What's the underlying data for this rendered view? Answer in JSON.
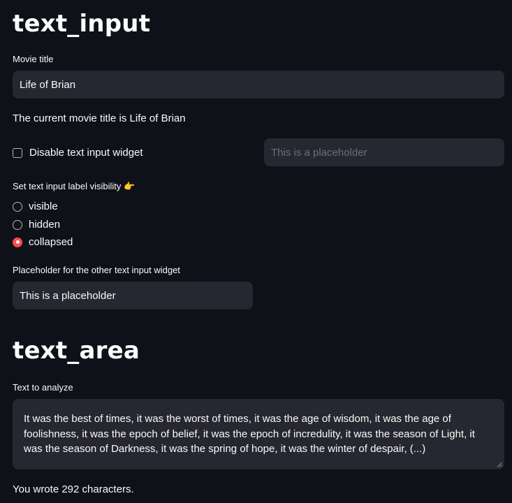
{
  "text_input_section": {
    "heading": "text_input",
    "movie_title_label": "Movie title",
    "movie_title_value": "Life of Brian",
    "current_title_text": "The current movie title is Life of Brian",
    "disable_checkbox_label": "Disable text input widget",
    "disable_checkbox_checked": false,
    "other_input_placeholder": "This is a placeholder",
    "visibility_label": "Set text input label visibility 👉",
    "visibility_options": [
      {
        "label": "visible",
        "selected": false
      },
      {
        "label": "hidden",
        "selected": false
      },
      {
        "label": "collapsed",
        "selected": true
      }
    ],
    "placeholder_label": "Placeholder for the other text input widget",
    "placeholder_value": "This is a placeholder"
  },
  "text_area_section": {
    "heading": "text_area",
    "analyze_label": "Text to analyze",
    "analyze_value": "It was the best of times, it was the worst of times, it was the age of wisdom, it was the age of foolishness, it was the epoch of belief, it was the epoch of incredulity, it was the season of Light, it was the season of Darkness, it was the spring of hope, it was the winter of despair, (...)",
    "char_count_text": "You wrote 292 characters."
  },
  "colors": {
    "background": "#0e1117",
    "input_bg": "#262730",
    "accent": "#ff4b4b",
    "text": "#fafafa",
    "placeholder": "#6c6f7a"
  }
}
